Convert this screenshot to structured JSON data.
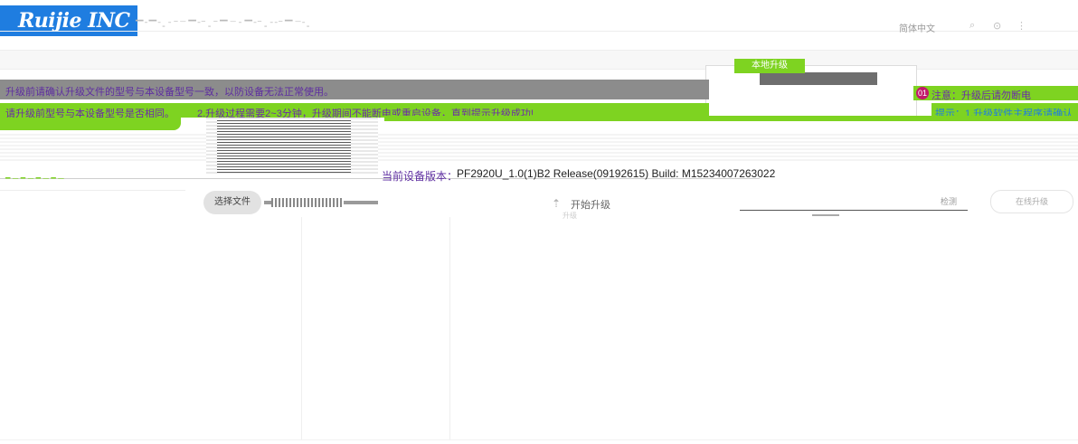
{
  "header": {
    "logo_text": "Ruijie INC",
    "language": "简体中文",
    "icons": [
      "search-icon",
      "help-icon",
      "user-icon"
    ]
  },
  "tabs": {
    "active_chip": "本地升级",
    "active_tab": "本地升级"
  },
  "notices": {
    "line1": "升级前请确认升级文件的型号与本设备型号一致，以防设备无法正常使用。",
    "line2_a": "请升级前型号与本设备型号是否相同。",
    "line2_b": "2.升级过程需要2~3分钟，升级期间不能断电或重启设备，直到提示升级成功!",
    "right_badge": "01",
    "right_line1": "注意：升级后请勿断电",
    "right_line2": "提示：1.升级软件主程序请确认"
  },
  "firmware": {
    "version_label": "当前设备版本：",
    "version_value": "PF2920U_1.0(1)B2 Release(09192615) Build: M15234007263022"
  },
  "actions": {
    "select_file": "选择文件",
    "start_upgrade": "开始升级",
    "start_sub": "升级",
    "right_label": "检测",
    "right_button": "在线升级"
  },
  "colors": {
    "brand": "#1f7de0",
    "accent_green": "#7ed321",
    "accent_purple": "#6b2ca8",
    "badge": "#c2186b"
  }
}
